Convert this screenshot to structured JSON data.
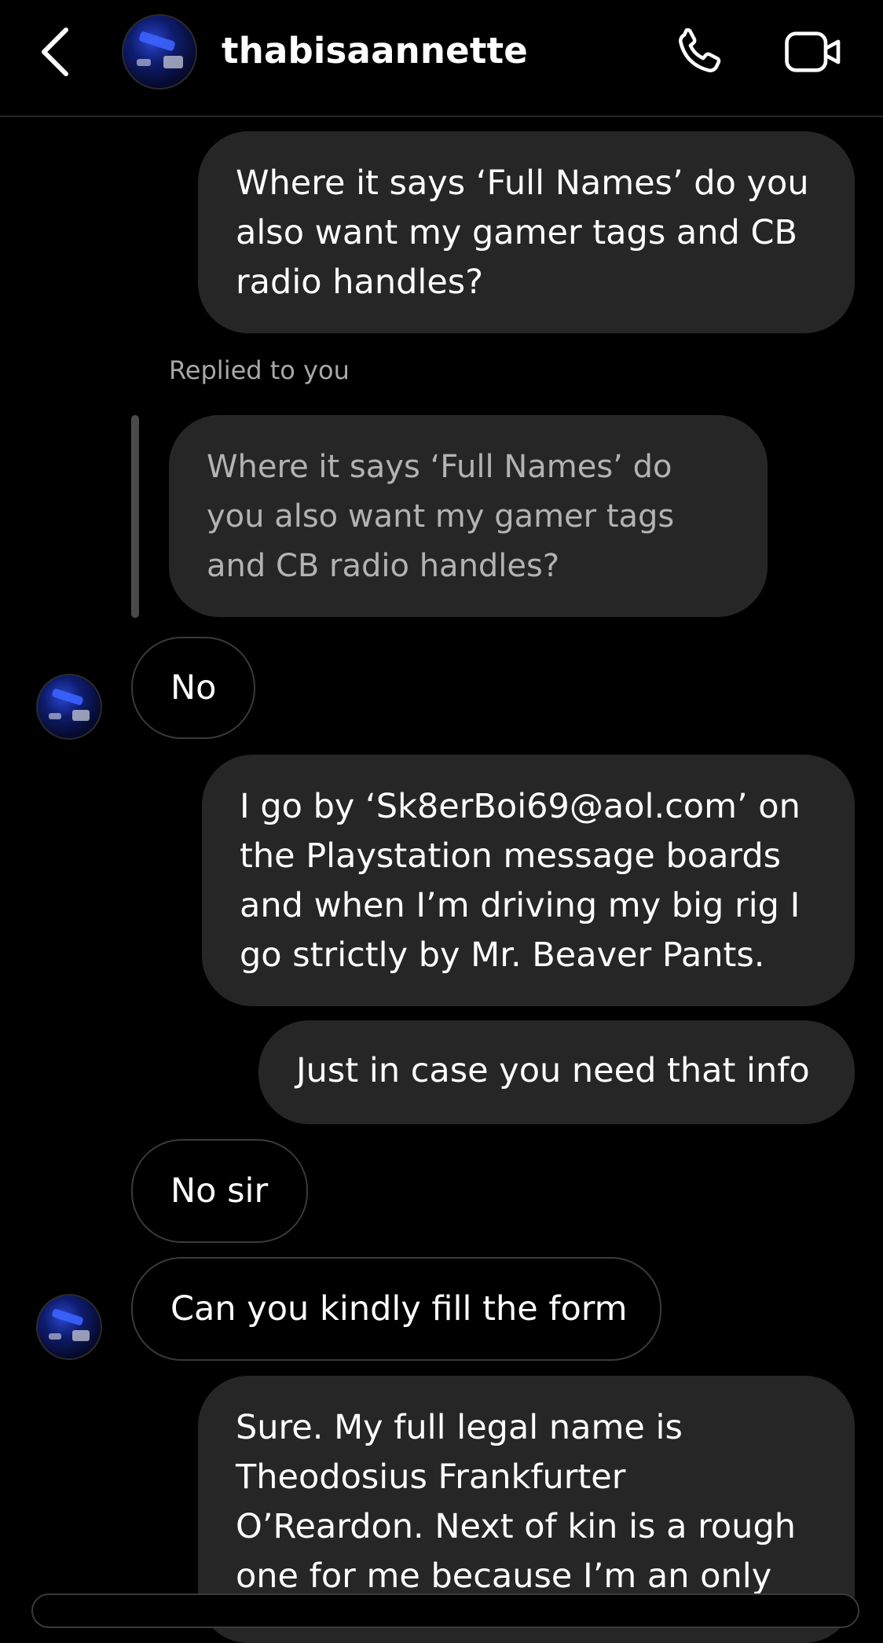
{
  "header": {
    "username": "thabisaannette",
    "back_icon": "chevron-left-icon",
    "call_icon": "phone-icon",
    "video_icon": "video-camera-icon"
  },
  "messages": [
    {
      "sender": "me",
      "text": "Where it says ‘Full Names’ do you also want my gamer tags and CB radio handles?"
    },
    {
      "sender": "them",
      "reply_label": "Replied to you",
      "quoted_text": "Where it says ‘Full Names’ do you also want my gamer tags and CB radio handles?",
      "text": "No"
    },
    {
      "sender": "me",
      "text": "I go by ‘Sk8erBoi69@aol.com’ on the Playstation message boards and when I’m driving my big rig I go strictly by Mr. Beaver Pants."
    },
    {
      "sender": "me",
      "text": "Just in case you need that info"
    },
    {
      "sender": "them",
      "text": "No sir"
    },
    {
      "sender": "them",
      "text": "Can you kindly fill the form"
    },
    {
      "sender": "me",
      "text": "Sure. My full legal name is Theodosius Frankfurter O’Reardon. Next of kin is a rough one for me because I’m an only"
    }
  ],
  "colors": {
    "background": "#000000",
    "outgoing_bubble": "#262626",
    "incoming_border": "#3a3a3a",
    "muted_text": "#a8a8a8"
  }
}
